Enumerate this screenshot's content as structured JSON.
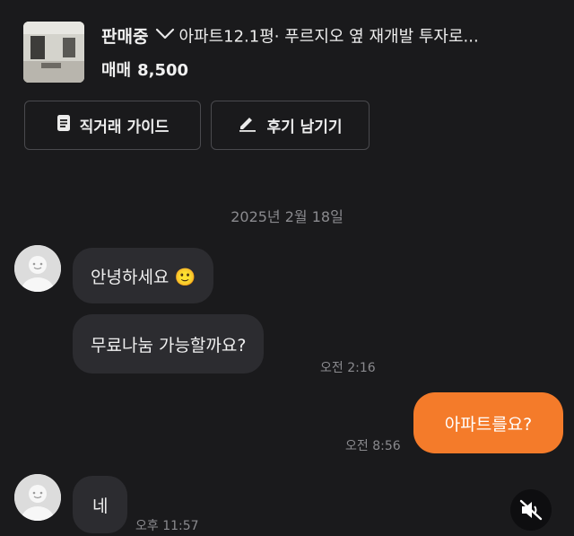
{
  "listing": {
    "status": "판매중",
    "title": "아파트12.1평· 푸르지오 옆 재개발 투자로...",
    "trade_type": "매매",
    "price": "8,500"
  },
  "actions": {
    "guide_label": "직거래 가이드",
    "review_label": "후기 남기기"
  },
  "chat": {
    "date": "2025년 2월 18일",
    "messages": [
      {
        "text": "안녕하세요 🙂",
        "from": "other"
      },
      {
        "text": "무료나눔 가능할까요?",
        "from": "other",
        "time": "오전 2:16"
      },
      {
        "text": "아파트를요?",
        "from": "me",
        "time": "오전 8:56"
      },
      {
        "text": "네",
        "from": "other",
        "time": "오후 11:57"
      }
    ]
  },
  "colors": {
    "background": "#1a1a1c",
    "bubble_other": "#2c2c30",
    "bubble_mine": "#f47b2a"
  },
  "icons": [
    "chevron-down-icon",
    "document-icon",
    "pencil-icon",
    "avatar-icon",
    "muted-speaker-icon"
  ]
}
